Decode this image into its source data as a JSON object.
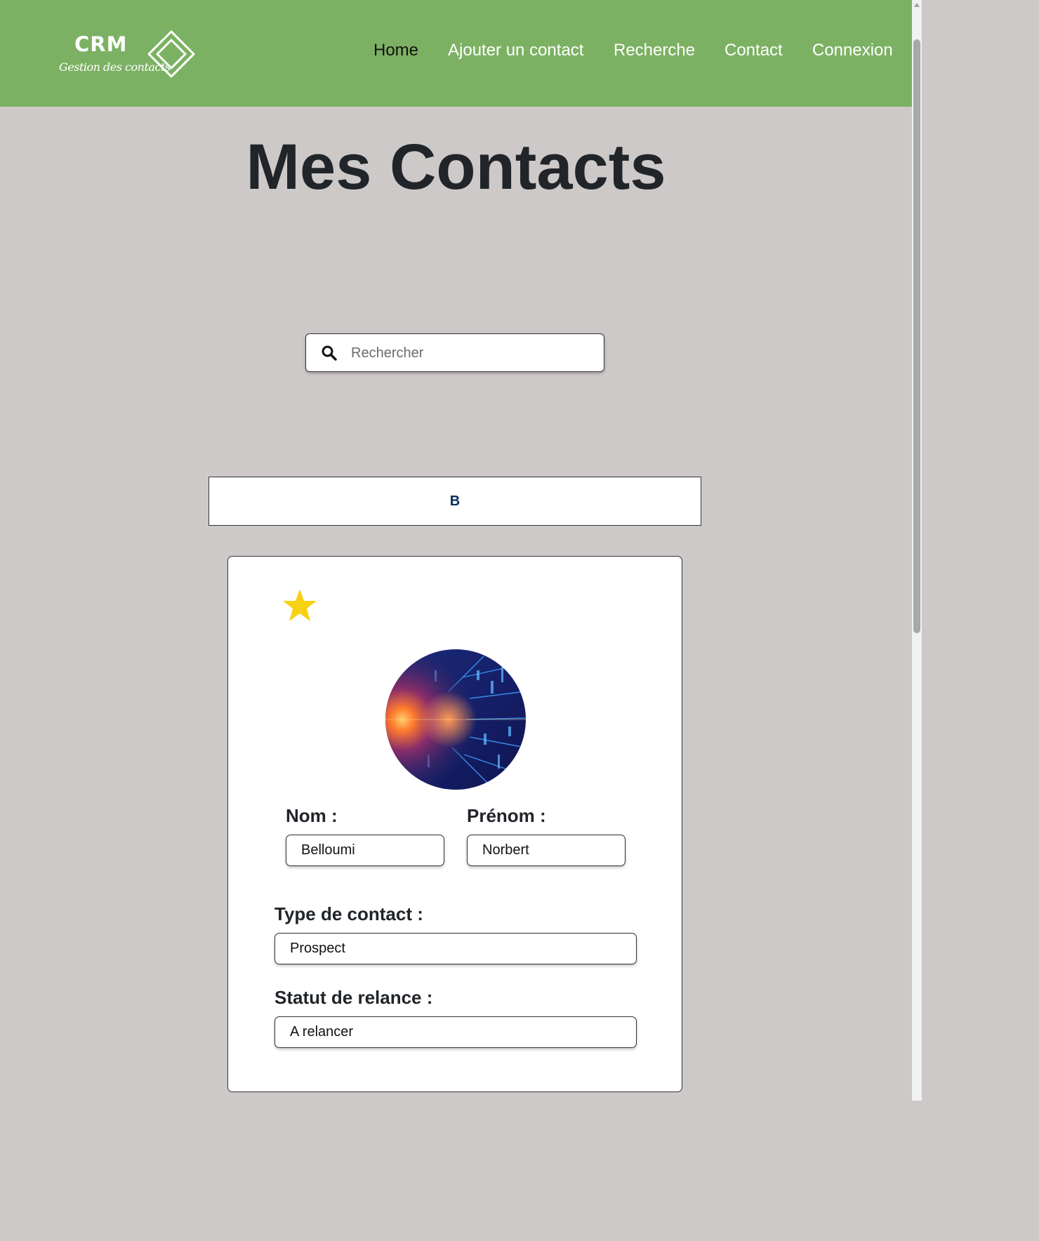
{
  "brand": {
    "name": "CRM",
    "subtitle": "Gestion des contacts",
    "logo_icon": "diamond-logo-icon"
  },
  "nav": {
    "items": [
      {
        "label": "Home",
        "active": true
      },
      {
        "label": "Ajouter un contact",
        "active": false
      },
      {
        "label": "Recherche",
        "active": false
      },
      {
        "label": "Contact",
        "active": false
      },
      {
        "label": "Connexion",
        "active": false
      }
    ]
  },
  "page": {
    "title": "Mes Contacts"
  },
  "search": {
    "placeholder": "Rechercher",
    "value": "",
    "icon": "search-icon"
  },
  "sections": [
    {
      "letter": "B",
      "contacts": [
        {
          "favorite": true,
          "nom_label": "Nom :",
          "nom": "Belloumi",
          "prenom_label": "Prénom :",
          "prenom": "Norbert",
          "type_label": "Type de contact :",
          "type": "Prospect",
          "statut_label": "Statut de relance :",
          "statut": "A relancer"
        }
      ]
    }
  ],
  "colors": {
    "header_bg": "#7cb163",
    "page_bg": "#cec9c9",
    "title_text": "#212529",
    "star": "#f7d114",
    "letter_text": "#0b2b5c"
  }
}
